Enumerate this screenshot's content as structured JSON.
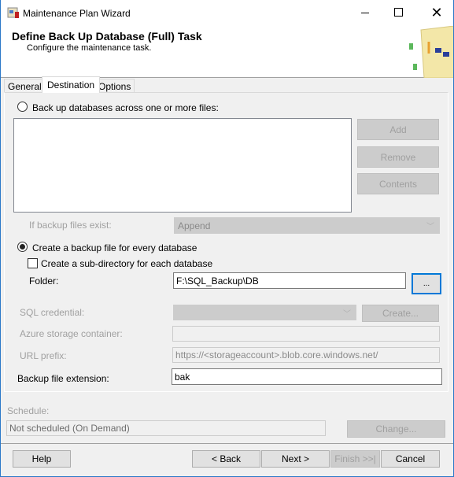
{
  "window": {
    "title": "Maintenance Plan Wizard",
    "app_icon": "wizard-icon",
    "minimize_icon": "minimize-icon",
    "maximize_icon": "maximize-icon",
    "close_icon": "close-icon"
  },
  "header": {
    "title": "Define Back Up Database (Full) Task",
    "subtitle": "Configure the maintenance task."
  },
  "tabs": [
    {
      "label": "General"
    },
    {
      "label": "Destination",
      "active": true
    },
    {
      "label": "Options"
    }
  ],
  "destination": {
    "across_files_label": "Back up databases across one or more files:",
    "across_files_selected": false,
    "add_label": "Add",
    "remove_label": "Remove",
    "contents_label": "Contents",
    "if_exist_label": "If backup files exist:",
    "if_exist_value": "Append",
    "every_db_label": "Create a backup file for every database",
    "every_db_selected": true,
    "subdir_label": "Create a sub-directory for each database",
    "subdir_checked": false,
    "folder_label": "Folder:",
    "folder_value": "F:\\SQL_Backup\\DB",
    "browse_label": "...",
    "sql_credential_label": "SQL credential:",
    "create_label": "Create...",
    "azure_label": "Azure storage container:",
    "url_prefix_label": "URL prefix:",
    "url_prefix_value": "https://<storageaccount>.blob.core.windows.net/",
    "extension_label": "Backup file extension:",
    "extension_value": "bak"
  },
  "schedule": {
    "label": "Schedule:",
    "value": "Not scheduled (On Demand)",
    "change_label": "Change..."
  },
  "footer": {
    "help": "Help",
    "back": "< Back",
    "next": "Next >",
    "finish": "Finish >>|",
    "cancel": "Cancel"
  }
}
